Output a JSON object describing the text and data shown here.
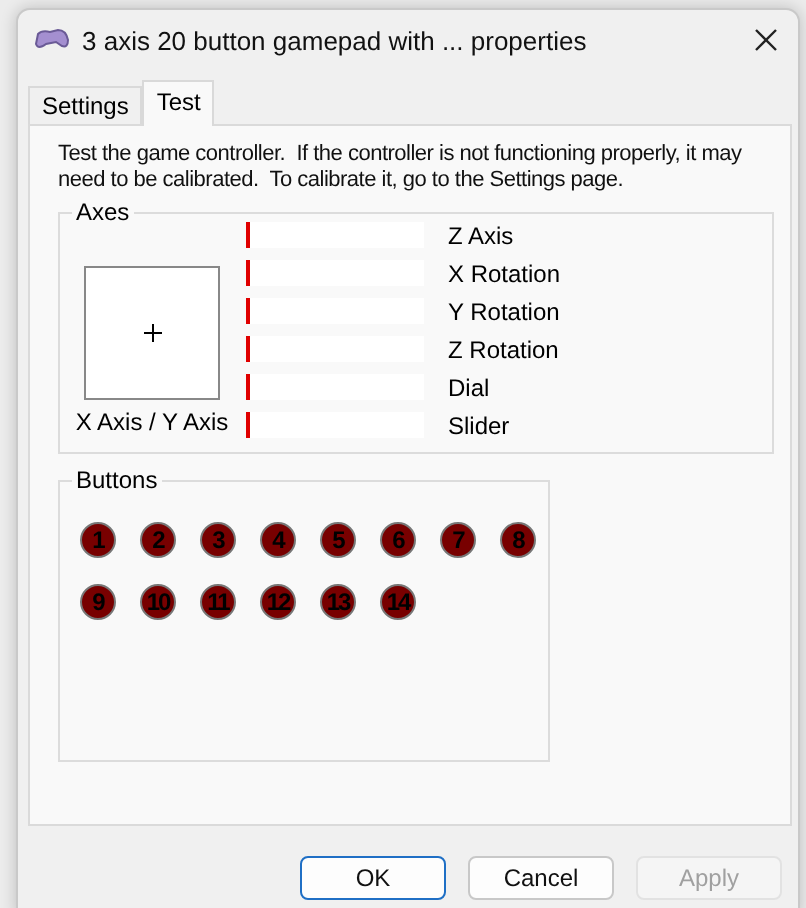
{
  "window": {
    "title": "3 axis 20 button gamepad with ... properties"
  },
  "tabs": [
    {
      "label": "Settings",
      "selected": false
    },
    {
      "label": "Test",
      "selected": true
    }
  ],
  "description": "Test the game controller.  If the controller is not functioning properly, it may need to be calibrated.  To calibrate it, go to the Settings page.",
  "axes": {
    "title": "Axes",
    "xy_label": "X Axis / Y Axis",
    "bars": [
      {
        "label": "Z Axis",
        "level": 0
      },
      {
        "label": "X Rotation",
        "level": 0
      },
      {
        "label": "Y Rotation",
        "level": 0
      },
      {
        "label": "Z Rotation",
        "level": 0
      },
      {
        "label": "Dial",
        "level": 0
      },
      {
        "label": "Slider",
        "level": 0
      }
    ]
  },
  "buttons_group": {
    "title": "Buttons",
    "buttons": [
      {
        "label": "1",
        "pressed": false
      },
      {
        "label": "2",
        "pressed": false
      },
      {
        "label": "3",
        "pressed": false
      },
      {
        "label": "4",
        "pressed": false
      },
      {
        "label": "5",
        "pressed": false
      },
      {
        "label": "6",
        "pressed": false
      },
      {
        "label": "7",
        "pressed": false
      },
      {
        "label": "8",
        "pressed": false
      },
      {
        "label": "9",
        "pressed": false
      },
      {
        "label": "10",
        "pressed": false
      },
      {
        "label": "11",
        "pressed": false
      },
      {
        "label": "12",
        "pressed": false
      },
      {
        "label": "13",
        "pressed": false
      },
      {
        "label": "14",
        "pressed": false
      }
    ]
  },
  "footer": [
    {
      "label": "OK",
      "default": true,
      "disabled": false
    },
    {
      "label": "Cancel",
      "default": false,
      "disabled": false
    },
    {
      "label": "Apply",
      "default": false,
      "disabled": true
    }
  ]
}
